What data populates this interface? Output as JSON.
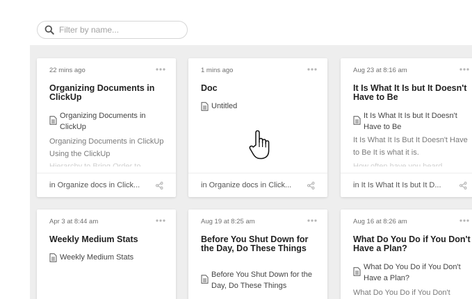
{
  "search": {
    "placeholder": "Filter by name...",
    "value": ""
  },
  "cards": [
    {
      "date": "22 mins ago",
      "title": "Organizing Documents in ClickUp",
      "doc_name": "Organizing Documents in ClickUp",
      "preview": "Organizing Documents in ClickUp Using the ClickUp",
      "preview_fade": "Hierarchy to Bring Order to",
      "location": "in Organize docs in Click..."
    },
    {
      "date": "1 mins ago",
      "title": "Doc",
      "doc_name": "Untitled",
      "location": "in Organize docs in Click..."
    },
    {
      "date": "Aug 23 at 8:16 am",
      "title": "It Is What It Is but It Doesn't Have to Be",
      "doc_name": "It Is What It Is but It Doesn't Have to Be",
      "preview": "It Is What It Is But It Doesn't Have to Be It is what it is.",
      "preview_fade": "How often have you heard",
      "location": "in It Is What It Is but It D..."
    },
    {
      "date": "Apr 3 at 8:44 am",
      "title": "Weekly Medium Stats",
      "doc_name": "Weekly Medium Stats"
    },
    {
      "date": "Aug 19 at 8:25 am",
      "title": "Before You Shut Down for the Day, Do These Things",
      "doc_name": "Before You Shut Down for the Day, Do These Things"
    },
    {
      "date": "Aug 16 at 8:26 am",
      "title": "What Do You Do if You Don't Have a Plan?",
      "doc_name": "What Do You Do if You Don't Have a Plan?",
      "preview": "What Do You Do if You Don't"
    }
  ],
  "icons": {
    "search": "search-icon",
    "more": "more-horizontal-icon",
    "doc": "document-icon",
    "share": "share-icon",
    "cursor": "hand-pointer-icon"
  },
  "colors": {
    "page_background": "#eeeeee",
    "card_background": "#ffffff"
  }
}
